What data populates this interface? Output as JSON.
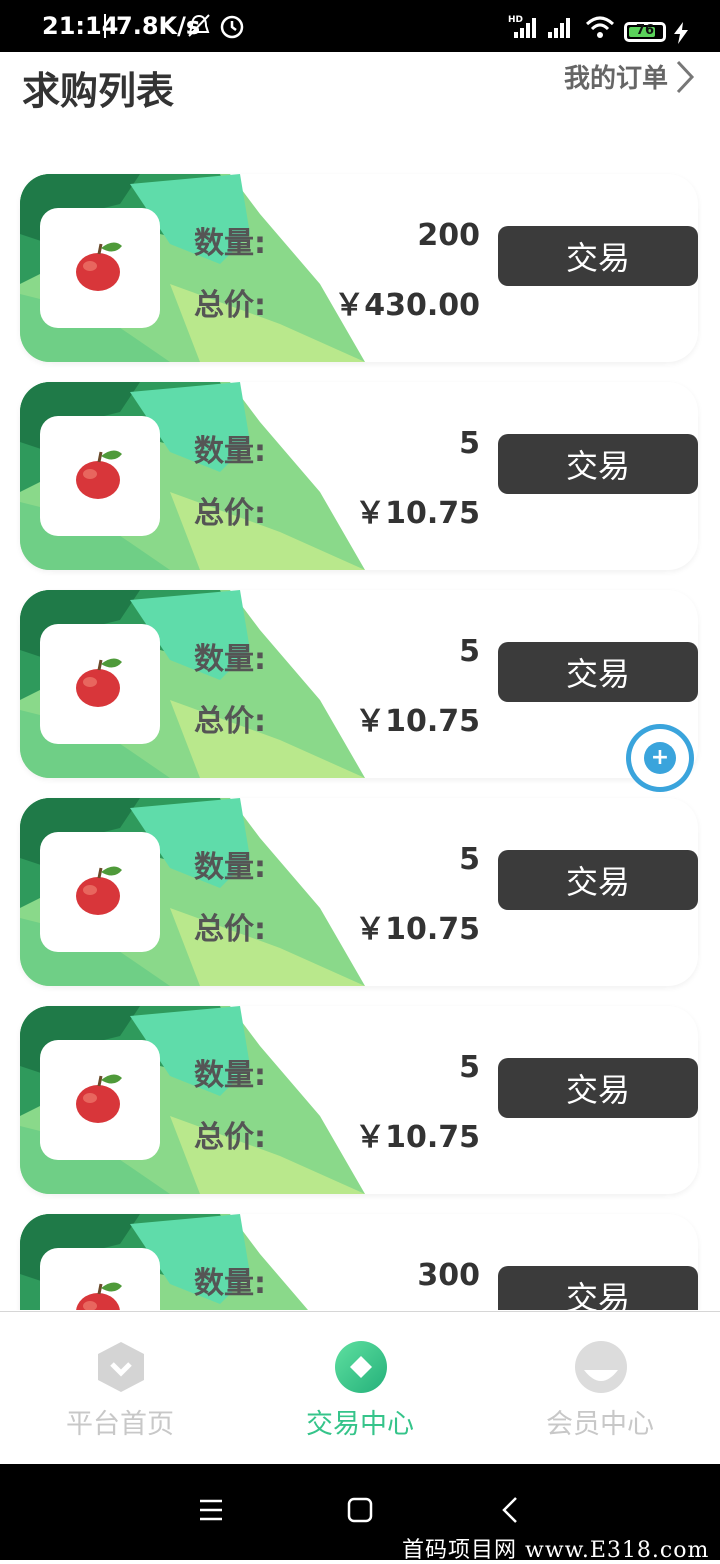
{
  "status_bar": {
    "time": "21:14",
    "net_speed": "7.8K/s",
    "battery": "76",
    "battery_level": 0.76
  },
  "header": {
    "title": "求购列表",
    "orders_link": "我的订单"
  },
  "list_labels": {
    "quantity": "数量:",
    "total": "总价:",
    "trade": "交易"
  },
  "orders": [
    {
      "quantity": "200",
      "total": "￥430.00"
    },
    {
      "quantity": "5",
      "total": "￥10.75"
    },
    {
      "quantity": "5",
      "total": "￥10.75"
    },
    {
      "quantity": "5",
      "total": "￥10.75"
    },
    {
      "quantity": "5",
      "total": "￥10.75"
    },
    {
      "quantity": "300",
      "total": ""
    }
  ],
  "tabs": [
    {
      "label": "平台首页",
      "icon": "home-hexagon-icon",
      "active": false
    },
    {
      "label": "交易中心",
      "icon": "trade-diamond-icon",
      "active": true
    },
    {
      "label": "会员中心",
      "icon": "member-circle-icon",
      "active": false
    }
  ],
  "colors": {
    "accent": "#35c48a",
    "inactive": "#c8c8c8",
    "button": "#3b3b3b"
  },
  "watermark": "首码项目网 www.E318.com"
}
